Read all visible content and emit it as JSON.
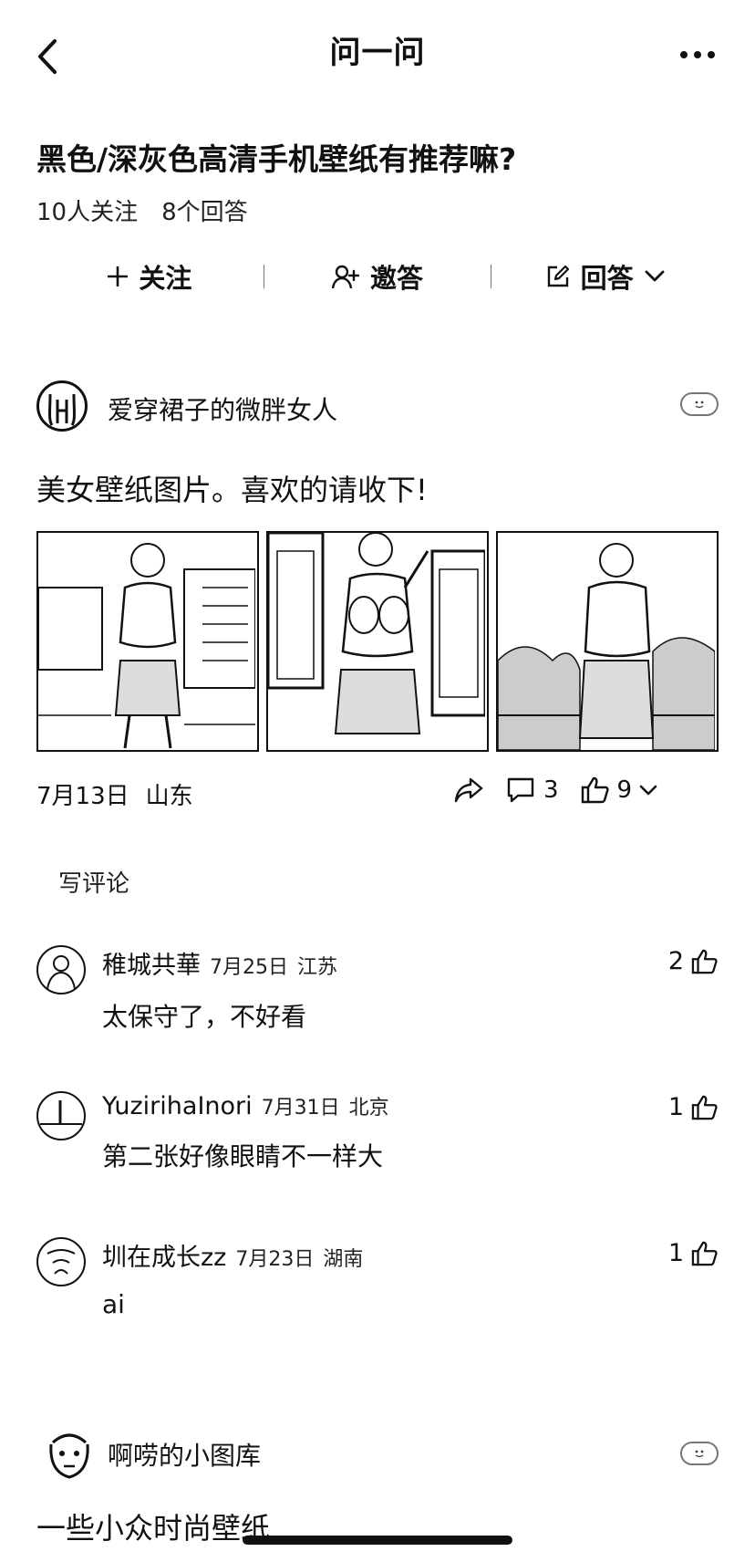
{
  "topbar": {
    "title": "问一问",
    "back_icon": "chevron-left-icon",
    "more_icon": "more-dots-icon"
  },
  "question": {
    "title": "黑色/深灰色高清手机壁纸有推荐嘛?",
    "followers": "10人关注",
    "answers": "8个回答"
  },
  "actions": {
    "follow_label": "关注",
    "invite_label": "邀答",
    "answer_label": "回答"
  },
  "answer": {
    "author": "爱穿裙子的微胖女人",
    "text": "美女壁纸图片。喜欢的请收下!",
    "date": "7月13日",
    "location": "山东",
    "comment_count": "3",
    "like_count": "9",
    "write_comment": "写评论"
  },
  "comments": [
    {
      "name": "稚城共華",
      "date": "7月25日",
      "location": "江苏",
      "text": "太保守了，不好看",
      "likes": "2"
    },
    {
      "name": "YuzirihaInori",
      "date": "7月31日",
      "location": "北京",
      "text": "第二张好像眼睛不一样大",
      "likes": "1"
    },
    {
      "name": "圳在成长zz",
      "date": "7月23日",
      "location": "湖南",
      "text": "ai",
      "likes": "1"
    }
  ],
  "next_answer": {
    "author": "啊唠的小图库",
    "text": "一些小众时尚壁纸"
  },
  "colors": {
    "text": "#111111",
    "background": "#ffffff",
    "muted": "#777777"
  }
}
